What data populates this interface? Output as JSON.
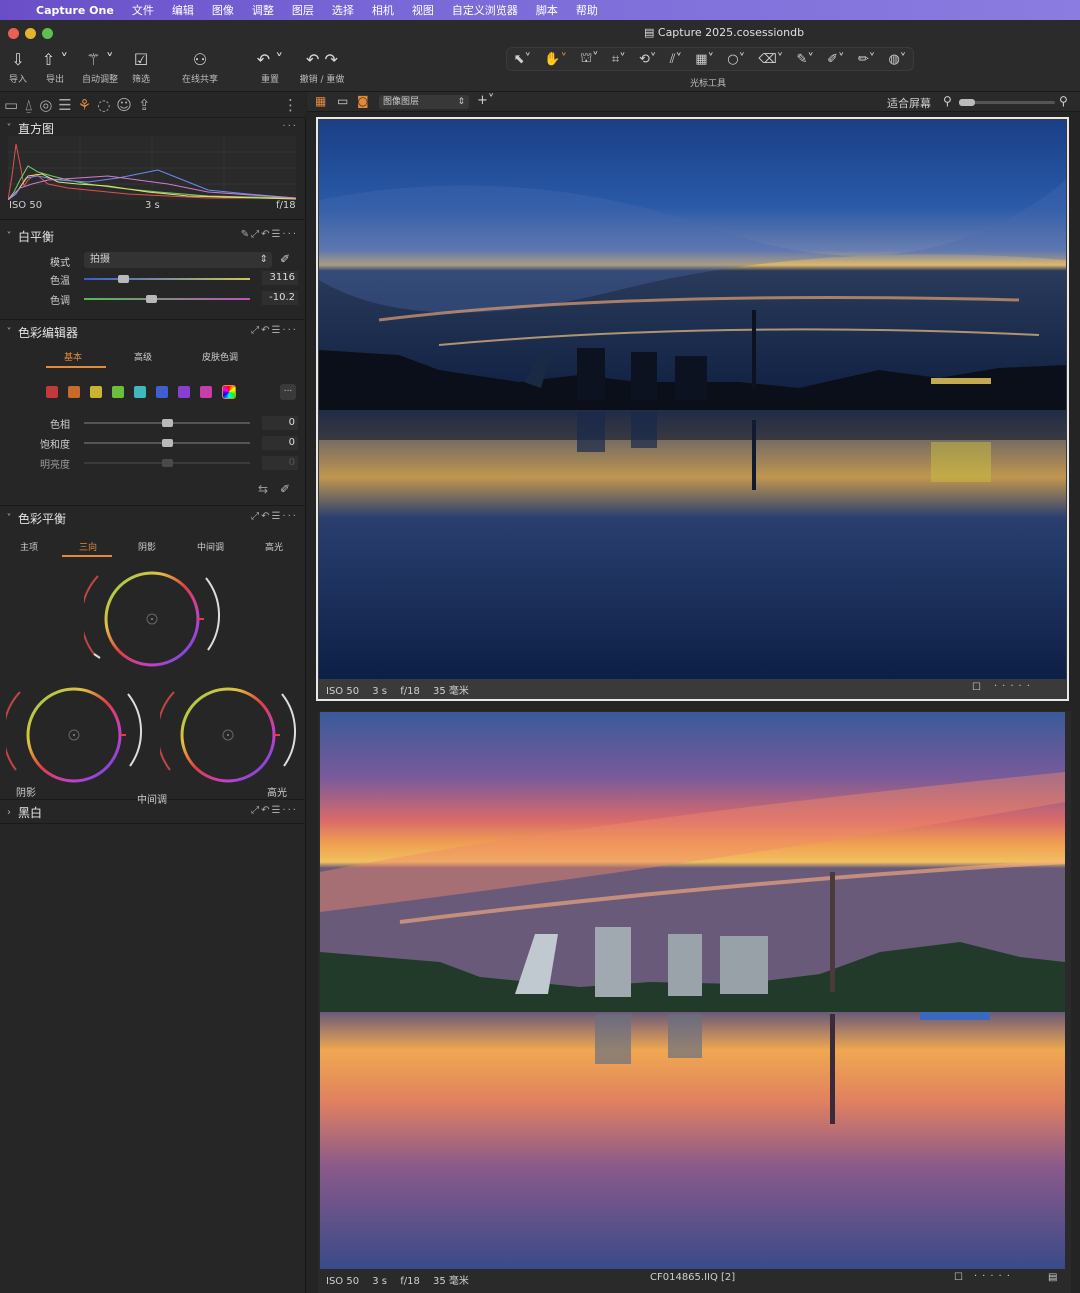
{
  "menu": {
    "items": [
      "Capture One",
      "文件",
      "编辑",
      "图像",
      "调整",
      "图层",
      "选择",
      "相机",
      "视图",
      "自定义浏览器",
      "脚本",
      "帮助"
    ]
  },
  "window": {
    "title": "Capture 2025.cosessiondb"
  },
  "toolbar": {
    "import": "导入",
    "export": "导出",
    "auto_adjust": "自动调整",
    "filter": "筛选",
    "share": "在线共享",
    "reset": "重置",
    "undo_redo": "撤销 / 重做",
    "cursor_tools": "光标工具"
  },
  "histogram": {
    "title": "直方图",
    "iso": "ISO 50",
    "shutter": "3 s",
    "aperture": "f/18"
  },
  "white_balance": {
    "title": "白平衡",
    "mode_label": "模式",
    "mode_value": "拍摄",
    "temp_label": "色温",
    "temp_value": "3116",
    "temp_level": 0.22,
    "tint_label": "色调",
    "tint_value": "-10.2",
    "tint_level": 0.4
  },
  "color_editor": {
    "title": "色彩编辑器",
    "tabs": [
      "基本",
      "高级",
      "皮肤色调"
    ],
    "swatches": [
      "#c43a3a",
      "#c86a2a",
      "#c9b52f",
      "#6cbf3c",
      "#3fb9b9",
      "#3f5fd0",
      "#8a3fd0",
      "#c43fa8"
    ],
    "hue_label": "色相",
    "hue_value": "0",
    "sat_label": "饱和度",
    "sat_value": "0",
    "light_label": "明亮度",
    "light_value": "0"
  },
  "color_balance": {
    "title": "色彩平衡",
    "tabs": [
      "主项",
      "三向",
      "阴影",
      "中间调",
      "高光"
    ],
    "midtones": "中间调",
    "shadows": "阴影",
    "highlights": "高光"
  },
  "bw": {
    "title": "黑白"
  },
  "viewer": {
    "layer": "图像图层",
    "fit": "适合屏幕",
    "top": {
      "iso": "ISO 50",
      "shutter": "3 s",
      "aperture": "f/18",
      "focal": "35 毫米"
    },
    "bottom": {
      "iso": "ISO 50",
      "shutter": "3 s",
      "aperture": "f/18",
      "focal": "35 毫米",
      "filename": "CF014865.IIQ [2]"
    }
  },
  "colors": {
    "accent": "#e08a3a",
    "menubar": "#6a4ec8"
  }
}
